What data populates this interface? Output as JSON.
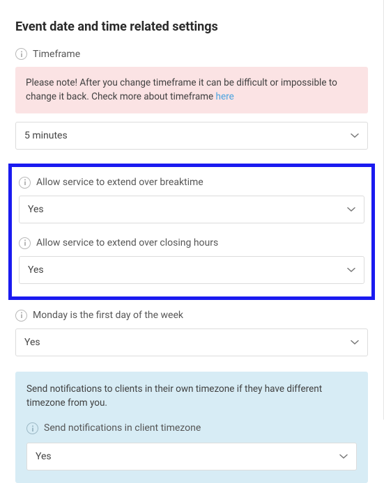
{
  "heading": "Event date and time related settings",
  "timeframe": {
    "label": "Timeframe",
    "alert_prefix": "Please note! After you change timeframe it can be difficult or impossible to change it back. Check more about timeframe ",
    "alert_link_text": "here",
    "value": "5 minutes"
  },
  "extend_breaktime": {
    "label": "Allow service to extend over breaktime",
    "value": "Yes"
  },
  "extend_closing": {
    "label": "Allow service to extend over closing hours",
    "value": "Yes"
  },
  "monday_first": {
    "label": "Monday is the first day of the week",
    "value": "Yes"
  },
  "client_tz": {
    "info_text": "Send notifications to clients in their own timezone if they have different timezone from you.",
    "label": "Send notifications in client timezone",
    "value": "Yes"
  }
}
